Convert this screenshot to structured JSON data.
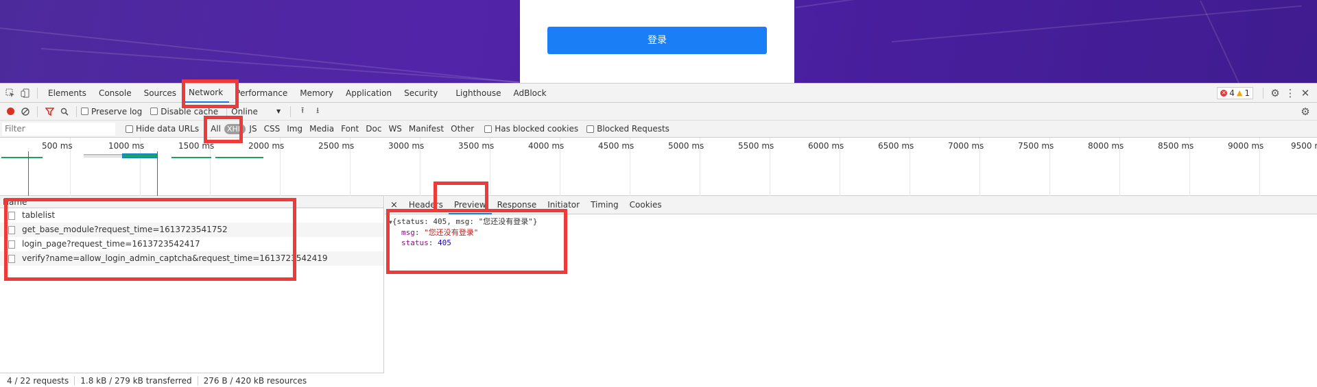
{
  "page": {
    "login_button": "登录"
  },
  "devtools": {
    "tabs": [
      {
        "label": "Elements"
      },
      {
        "label": "Console"
      },
      {
        "label": "Sources"
      },
      {
        "label": "Network"
      },
      {
        "label": "Performance"
      },
      {
        "label": "Memory"
      },
      {
        "label": "Application"
      },
      {
        "label": "Security"
      },
      {
        "label": "Lighthouse"
      },
      {
        "label": "AdBlock"
      }
    ],
    "error_count": "4",
    "warning_count": "1",
    "toolbar": {
      "preserve_log": "Preserve log",
      "disable_cache": "Disable cache",
      "throttle": "Online"
    },
    "filterbar": {
      "placeholder": "Filter",
      "hide_data_urls": "Hide data URLs",
      "types": [
        "All",
        "XHR",
        "JS",
        "CSS",
        "Img",
        "Media",
        "Font",
        "Doc",
        "WS",
        "Manifest",
        "Other"
      ],
      "has_blocked_cookies": "Has blocked cookies",
      "blocked_requests": "Blocked Requests"
    },
    "timeline_ticks": [
      "500 ms",
      "1000 ms",
      "1500 ms",
      "2000 ms",
      "2500 ms",
      "3000 ms",
      "3500 ms",
      "4000 ms",
      "4500 ms",
      "5000 ms",
      "5500 ms",
      "6000 ms",
      "6500 ms",
      "7000 ms",
      "7500 ms",
      "8000 ms",
      "8500 ms",
      "9000 ms",
      "9500 ms"
    ],
    "name_header": "Name",
    "requests": [
      "tablelist",
      "get_base_module?request_time=1613723541752",
      "login_page?request_time=1613723542417",
      "verify?name=allow_login_admin_captcha&request_time=1613723542419"
    ],
    "status": {
      "requests": "4 / 22 requests",
      "transferred": "1.8 kB / 279 kB transferred",
      "resources": "276 B / 420 kB resources"
    },
    "detail_close": "×",
    "detail_tabs": [
      "Headers",
      "Preview",
      "Response",
      "Initiator",
      "Timing",
      "Cookies"
    ],
    "preview": {
      "summary": "{status: 405, msg: \"您还没有登录\"}",
      "msg_key": "msg",
      "msg_value": "\"您还没有登录\"",
      "status_key": "status",
      "status_value": "405"
    }
  }
}
